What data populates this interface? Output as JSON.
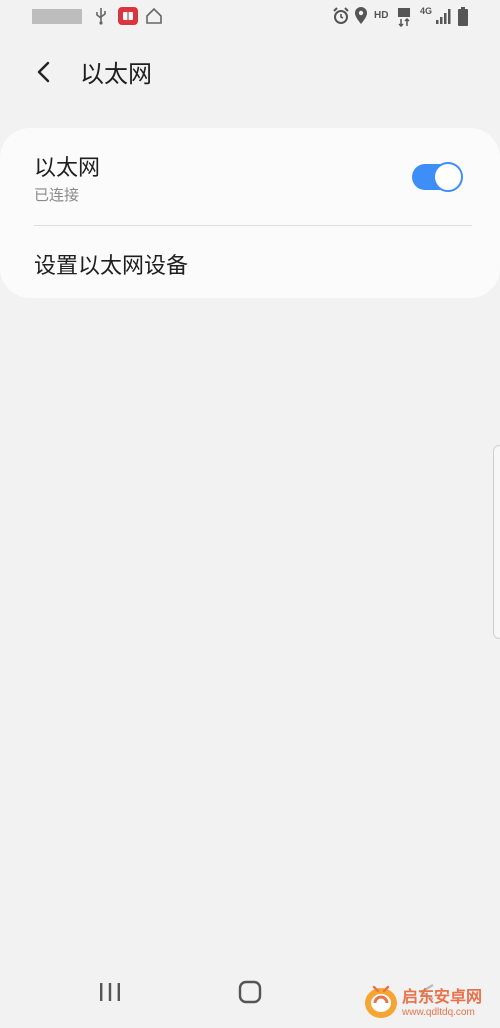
{
  "status_bar": {
    "hd_label": "HD",
    "network_label": "4G",
    "icons": [
      "usb-icon",
      "app-notification-icon",
      "home-icon",
      "alarm-icon",
      "location-icon",
      "hd-icon",
      "data-transfer-icon",
      "network-4g-icon",
      "signal-icon",
      "battery-icon"
    ]
  },
  "header": {
    "title": "以太网",
    "back_icon": "back-arrow-icon"
  },
  "ethernet_row": {
    "title": "以太网",
    "subtitle": "已连接",
    "toggle_on": true,
    "toggle_color": "#3e8ef7"
  },
  "setup_row": {
    "label": "设置以太网设备"
  },
  "nav_bar": {
    "icons": [
      "recent-apps-icon",
      "home-button-icon",
      "back-nav-icon"
    ]
  },
  "watermark": {
    "text_line1": "启东安卓网",
    "text_line2": "www.qdltdq.com",
    "color": "#e8734a"
  }
}
